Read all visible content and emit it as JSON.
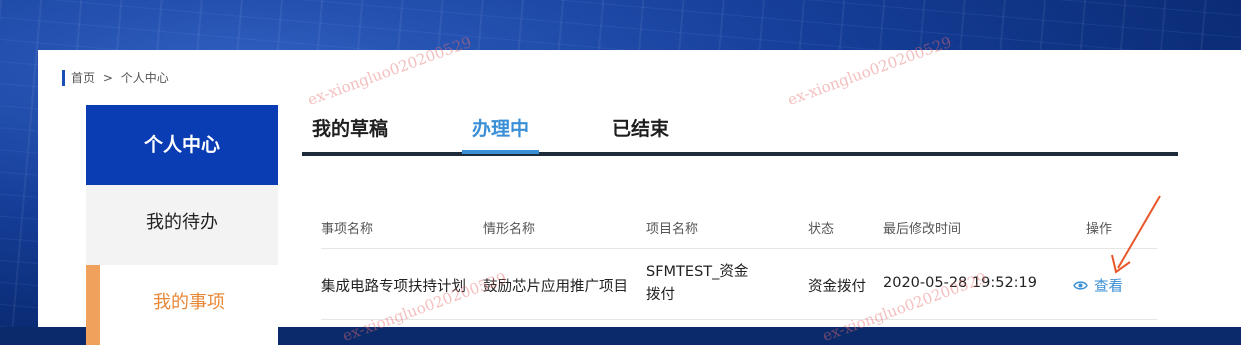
{
  "breadcrumb": {
    "home": "首页",
    "separator": ">",
    "current": "个人中心"
  },
  "sidebar": {
    "header": "个人中心",
    "items": [
      {
        "label": "我的待办",
        "active": false
      },
      {
        "label": "我的事项",
        "active": true
      }
    ]
  },
  "tabs": [
    {
      "label": "我的草稿",
      "active": false
    },
    {
      "label": "办理中",
      "active": true
    },
    {
      "label": "已结束",
      "active": false
    }
  ],
  "table": {
    "columns": [
      "事项名称",
      "情形名称",
      "项目名称",
      "状态",
      "最后修改时间",
      "操作"
    ],
    "rows": [
      {
        "item_name": "集成电路专项扶持计划",
        "scenario": "鼓励芯片应用推广项目",
        "project_line1": "SFMTEST_资金",
        "project_line2": "拨付",
        "status": "资金拨付",
        "modified": "2020-05-28 19:52:19",
        "action": "查看"
      }
    ]
  },
  "watermarks": [
    "ex-xiongluo020200529",
    "ex-xiongluo020200529",
    "ex-xiongluo020200529",
    "ex-xiongluo020200529"
  ],
  "colors": {
    "primary": "#0a3cb4",
    "accent": "#3a8fd6",
    "active_side": "#e8893a",
    "annotation_arrow": "#e8572a"
  },
  "icons": {
    "view": "eye-icon"
  }
}
